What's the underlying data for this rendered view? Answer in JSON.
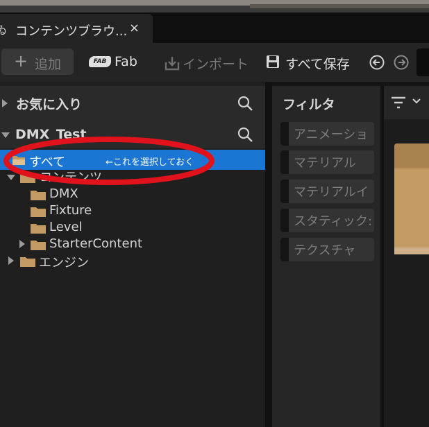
{
  "tab": {
    "title": "コンテンツブラウ...",
    "close": "×"
  },
  "toolbar": {
    "add_label": "追加",
    "fab_label": "Fab",
    "fab_icon_text": "FAB",
    "import_label": "インポート",
    "save_all_label": "すべて保存"
  },
  "sidebar": {
    "favorites_label": "お気に入り",
    "project_label": "DMX_Test",
    "all_label": "すべて",
    "annotation": "←これを選択しておく",
    "tree": {
      "content": "コンテンツ",
      "dmx": "DMX",
      "fixture": "Fixture",
      "level": "Level",
      "starter": "StarterContent",
      "engine": "エンジン"
    }
  },
  "filters": {
    "title": "フィルタ",
    "items": [
      "アニメーショ",
      "マテリアル",
      "マテリアルイ",
      "スタティック:",
      "テクスチャ"
    ]
  },
  "colors": {
    "selection": "#1a76d2",
    "annotation_ellipse": "#e0121c",
    "folder": "#c49a63"
  },
  "icons": {
    "tab": "content-browser-icon",
    "add": "plus-icon",
    "import": "import-icon",
    "save": "save-icon",
    "back": "back-arrow-icon",
    "forward": "forward-arrow-icon",
    "search": "search-icon",
    "filter": "filter-icon"
  }
}
